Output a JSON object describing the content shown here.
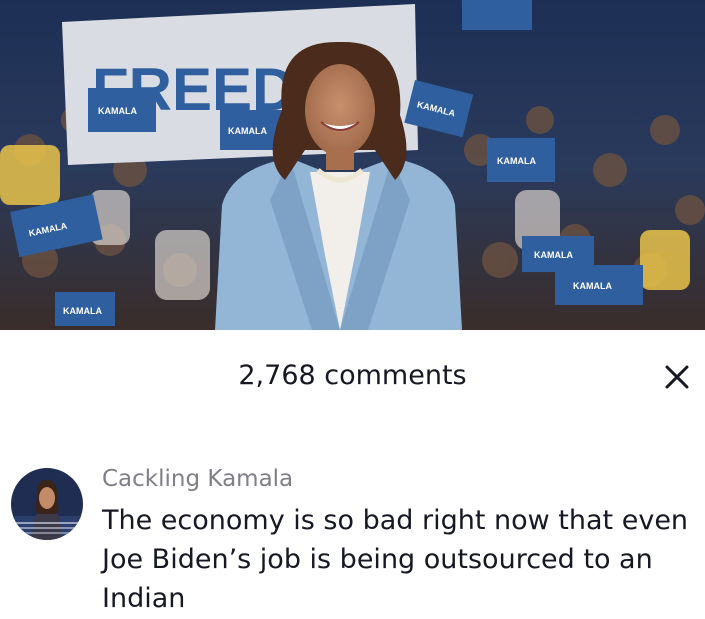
{
  "photo": {
    "banner_text": "FREED",
    "sign_text": "KAMALA"
  },
  "comments_panel": {
    "title": "2,768 comments",
    "close_icon": "close-icon"
  },
  "comment": {
    "username": "Cackling Kamala",
    "text": "The economy is so bad right now that even Joe Biden’s job is being outsourced to an Indian",
    "avatar_icon": "avatar"
  },
  "colors": {
    "sign_blue": "#2f5f9e",
    "suit_blue": "#93b6d6",
    "text_dark": "#161823",
    "text_gray": "#7f7f87"
  }
}
